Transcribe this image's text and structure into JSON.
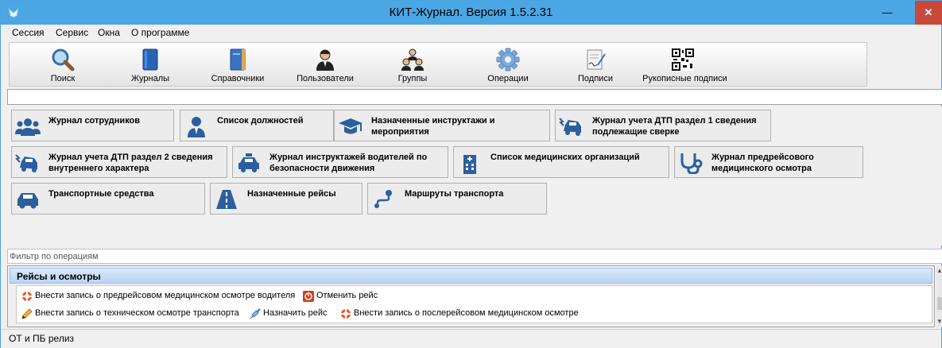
{
  "window": {
    "title": "КИТ-Журнал. Версия 1.5.2.31",
    "accent": "#4aa7e3"
  },
  "menu": {
    "items": [
      "Сессия",
      "Сервис",
      "Окна",
      "О программе"
    ]
  },
  "toolbar": {
    "items": [
      {
        "label": "Поиск",
        "icon": "magnifier-icon"
      },
      {
        "label": "Журналы",
        "icon": "journal-book-icon"
      },
      {
        "label": "Справочники",
        "icon": "reference-book-icon"
      },
      {
        "label": "Пользователи",
        "icon": "user-icon"
      },
      {
        "label": "Группы",
        "icon": "group-icon"
      },
      {
        "label": "Операции",
        "icon": "gear-icon"
      },
      {
        "label": "Подписи",
        "icon": "signature-icon"
      },
      {
        "label": "Рукописные подписи",
        "icon": "qr-code-icon"
      }
    ]
  },
  "command": {
    "value": ""
  },
  "tiles": [
    {
      "label": "Журнал сотрудников",
      "icon": "employees-icon"
    },
    {
      "label": "Список должностей",
      "icon": "position-icon"
    },
    {
      "label": "Назначенные инструктажи и мероприятия",
      "icon": "graduation-cap-icon"
    },
    {
      "label": "Журнал учета ДТП раздел 1 сведения подлежащие сверке",
      "icon": "car-crash-icon"
    },
    {
      "label": "Журнал учета ДТП раздел 2 сведения внутреннего характера",
      "icon": "car-crash-icon"
    },
    {
      "label": "Журнал инструктажей водителей по безопасности движения",
      "icon": "taxi-icon"
    },
    {
      "label": "Список медицинских организаций",
      "icon": "hospital-icon"
    },
    {
      "label": "Журнал предрейсового медицинского осмотра",
      "icon": "stethoscope-icon"
    },
    {
      "label": "Транспортные средства",
      "icon": "car-icon"
    },
    {
      "label": "Назначенные рейсы",
      "icon": "road-icon"
    },
    {
      "label": "Маршруты транспорта",
      "icon": "route-icon"
    }
  ],
  "filter": {
    "placeholder": "Фильтр по операциям"
  },
  "operations": {
    "group_title": "Рейсы и осмотры",
    "items": [
      {
        "label": "Внести запись о предрейсовом медицинском осмотре водителя",
        "icon": "lifebuoy-icon"
      },
      {
        "label": "Отменить рейс",
        "icon": "cancel-icon"
      },
      {
        "label": "Внести запись о техническом осмотре транспорта",
        "icon": "pencil-icon"
      },
      {
        "label": "Назначить рейс",
        "icon": "syringe-icon"
      },
      {
        "label": "Внести запись о послерейсовом медицинском осмотре",
        "icon": "lifebuoy-icon"
      }
    ]
  },
  "status": {
    "text": "ОТ и ПБ релиз"
  },
  "colors": {
    "tile_icon": "#2c5f9e",
    "group_header": "#b9d3f3",
    "close_button": "#c9483c"
  }
}
